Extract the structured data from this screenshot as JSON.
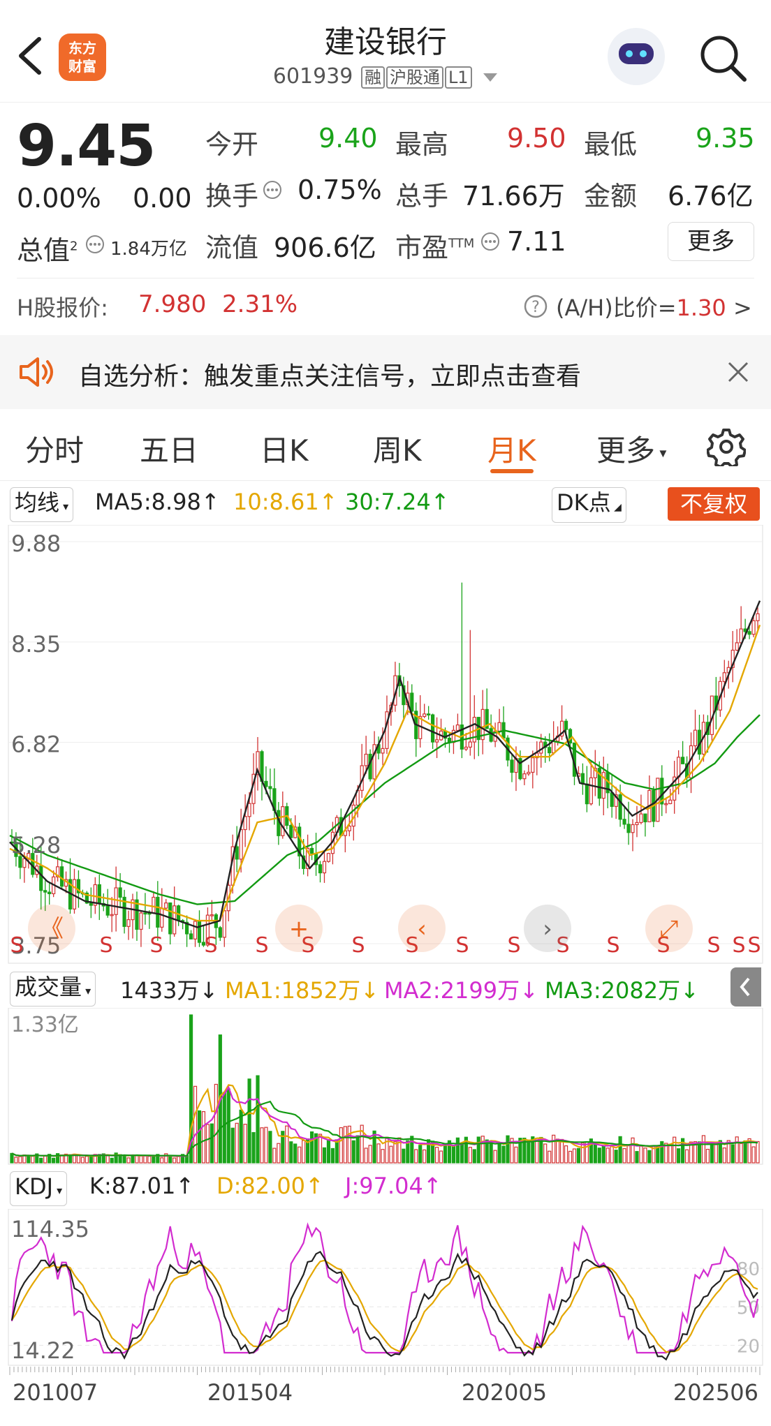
{
  "header": {
    "back_icon": "chevron-left-icon",
    "logo_line1": "东方",
    "logo_line2": "财富",
    "title": "建设银行",
    "code": "601939",
    "tags": [
      "融",
      "沪股通",
      "L1"
    ],
    "dropdown_icon": "triangle-down-icon",
    "avatar_icon": "robot-avatar-icon",
    "search_icon": "search-icon"
  },
  "quote": {
    "price": "9.45",
    "pct": "0.00%",
    "change": "0.00",
    "total_value_label": "总值",
    "total_value_sup": "2",
    "total_value": "1.84万亿",
    "open_label": "今开",
    "open": "9.40",
    "high_label": "最高",
    "high": "9.50",
    "low_label": "最低",
    "low": "9.35",
    "turnover_label": "换手",
    "turnover": "0.75%",
    "volume_label": "总手",
    "volume": "71.66万",
    "amount_label": "金额",
    "amount": "6.76亿",
    "float_label": "流值",
    "float": "906.6亿",
    "pe_label": "市盈",
    "pe_sup": "TTM",
    "pe": "7.11",
    "more_button": "更多"
  },
  "hshare": {
    "label": "H股报价:",
    "price": "7.980",
    "pct": "2.31%",
    "ratio_label": "(A/H)比价=",
    "ratio": "1.30",
    "arrow": ">"
  },
  "banner": {
    "text": "自选分析：触发重点关注信号，立即点击查看",
    "speaker_icon": "speaker-icon",
    "close_icon": "close-icon"
  },
  "tabs": [
    "分时",
    "五日",
    "日K",
    "周K",
    "月K",
    "更多"
  ],
  "active_tab": "月K",
  "settings_icon": "gear-icon",
  "ma_legend": {
    "selector": "均线",
    "ma5": "MA5:8.98",
    "ma10": "10:8.61",
    "ma30": "30:7.24",
    "up_arrow": "↑",
    "dk": "DK点",
    "adjust": "不复权"
  },
  "vol_legend": {
    "selector": "成交量",
    "value": "1433万",
    "ma1": "MA1:1852万",
    "ma2": "MA2:2199万",
    "ma3": "MA3:2082万",
    "down_arrow": "↓"
  },
  "kdj_legend": {
    "selector": "KDJ",
    "k": "K:87.01",
    "d": "D:82.00",
    "j": "J:97.04",
    "up_arrow": "↑"
  },
  "signal_label": "S",
  "x_axis": [
    "201007",
    "201504",
    "202005",
    "202506"
  ],
  "chart_data": [
    {
      "type": "candlestick",
      "title": "月K",
      "yticks": [
        "9.88",
        "8.35",
        "6.82",
        "5.28",
        "3.75"
      ],
      "ylim": [
        3.75,
        9.88
      ],
      "x_range": [
        "201007",
        "202506"
      ],
      "series": [
        {
          "name": "MA5",
          "last": 8.98,
          "color": "#222222"
        },
        {
          "name": "10",
          "last": 8.61,
          "color": "#e4a700"
        },
        {
          "name": "30",
          "last": 7.24,
          "color": "#129a12"
        }
      ],
      "ma5_path": [
        [
          0,
          5.3
        ],
        [
          0.05,
          4.7
        ],
        [
          0.1,
          4.4
        ],
        [
          0.15,
          4.3
        ],
        [
          0.2,
          4.2
        ],
        [
          0.25,
          4.0
        ],
        [
          0.28,
          4.1
        ],
        [
          0.3,
          5.2
        ],
        [
          0.33,
          6.4
        ],
        [
          0.36,
          5.6
        ],
        [
          0.4,
          4.9
        ],
        [
          0.43,
          5.3
        ],
        [
          0.46,
          6.0
        ],
        [
          0.5,
          7.0
        ],
        [
          0.52,
          7.8
        ],
        [
          0.54,
          7.1
        ],
        [
          0.58,
          6.9
        ],
        [
          0.62,
          7.1
        ],
        [
          0.65,
          6.9
        ],
        [
          0.68,
          6.5
        ],
        [
          0.72,
          6.8
        ],
        [
          0.74,
          7.0
        ],
        [
          0.76,
          6.2
        ],
        [
          0.8,
          6.1
        ],
        [
          0.83,
          5.7
        ],
        [
          0.86,
          5.9
        ],
        [
          0.9,
          6.4
        ],
        [
          0.93,
          7.0
        ],
        [
          0.96,
          7.9
        ],
        [
          1.0,
          8.98
        ]
      ],
      "ma10_path": [
        [
          0,
          5.2
        ],
        [
          0.05,
          4.9
        ],
        [
          0.1,
          4.5
        ],
        [
          0.15,
          4.4
        ],
        [
          0.2,
          4.3
        ],
        [
          0.25,
          4.1
        ],
        [
          0.28,
          4.1
        ],
        [
          0.3,
          4.7
        ],
        [
          0.33,
          5.6
        ],
        [
          0.37,
          5.7
        ],
        [
          0.4,
          5.1
        ],
        [
          0.43,
          5.2
        ],
        [
          0.46,
          5.7
        ],
        [
          0.5,
          6.5
        ],
        [
          0.53,
          7.3
        ],
        [
          0.56,
          7.1
        ],
        [
          0.6,
          6.9
        ],
        [
          0.64,
          7.1
        ],
        [
          0.68,
          6.6
        ],
        [
          0.72,
          6.6
        ],
        [
          0.75,
          6.9
        ],
        [
          0.78,
          6.4
        ],
        [
          0.82,
          6.0
        ],
        [
          0.85,
          5.8
        ],
        [
          0.88,
          6.0
        ],
        [
          0.92,
          6.5
        ],
        [
          0.96,
          7.3
        ],
        [
          1.0,
          8.61
        ]
      ],
      "ma30_path": [
        [
          0,
          5.4
        ],
        [
          0.05,
          5.1
        ],
        [
          0.1,
          4.9
        ],
        [
          0.15,
          4.7
        ],
        [
          0.2,
          4.5
        ],
        [
          0.25,
          4.35
        ],
        [
          0.3,
          4.4
        ],
        [
          0.33,
          4.7
        ],
        [
          0.37,
          5.1
        ],
        [
          0.41,
          5.3
        ],
        [
          0.45,
          5.7
        ],
        [
          0.5,
          6.2
        ],
        [
          0.54,
          6.5
        ],
        [
          0.58,
          6.8
        ],
        [
          0.62,
          6.9
        ],
        [
          0.66,
          7.0
        ],
        [
          0.7,
          6.9
        ],
        [
          0.74,
          6.8
        ],
        [
          0.78,
          6.5
        ],
        [
          0.82,
          6.2
        ],
        [
          0.86,
          6.1
        ],
        [
          0.9,
          6.2
        ],
        [
          0.94,
          6.5
        ],
        [
          0.97,
          6.9
        ],
        [
          1.0,
          7.24
        ]
      ]
    },
    {
      "type": "bar",
      "title": "成交量",
      "ylim": [
        0,
        1.33
      ],
      "yticks": [
        "1.33亿"
      ],
      "series": [
        {
          "name": "MA1",
          "last": "1852万",
          "color": "#e4a700"
        },
        {
          "name": "MA2",
          "last": "2199万",
          "color": "#d22ccf"
        },
        {
          "name": "MA3",
          "last": "2082万",
          "color": "#129a12"
        }
      ],
      "last_volume": "1433万",
      "peak_value": 1.33
    },
    {
      "type": "line",
      "title": "KDJ",
      "ylim": [
        14.22,
        114.35
      ],
      "yticks": [
        "114.35",
        "14.22"
      ],
      "ref_levels": [
        "80",
        "50",
        "20"
      ],
      "series": [
        {
          "name": "K",
          "last": 87.01,
          "color": "#222222"
        },
        {
          "name": "D",
          "last": 82.0,
          "color": "#e4a700"
        },
        {
          "name": "J",
          "last": 97.04,
          "color": "#d22ccf"
        }
      ]
    }
  ]
}
